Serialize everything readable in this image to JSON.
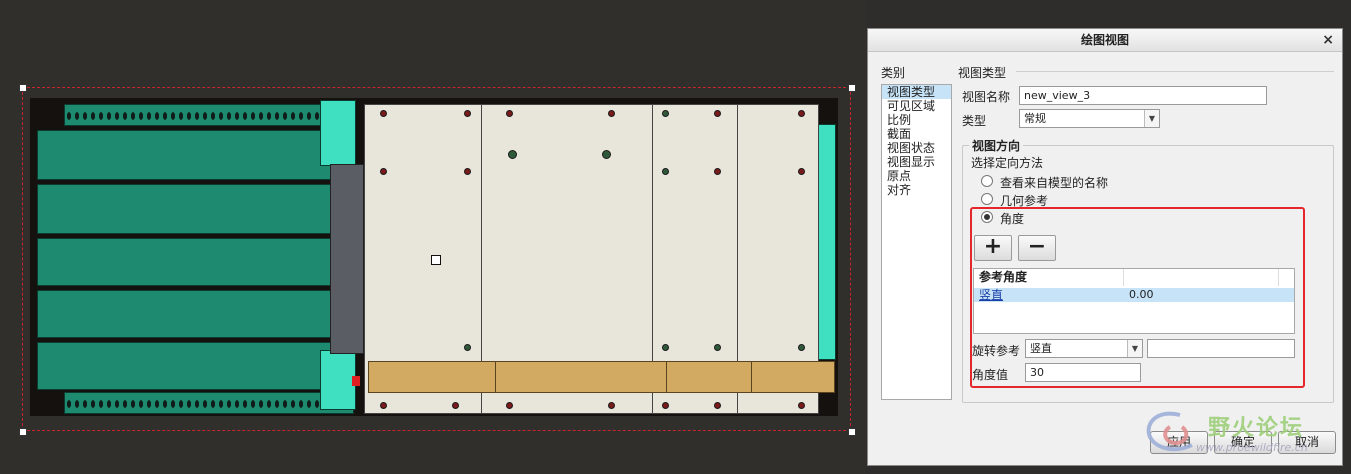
{
  "dialog": {
    "title": "绘图视图",
    "close": "×",
    "category_label": "类别",
    "categories": [
      "视图类型",
      "可见区域",
      "比例",
      "截面",
      "视图状态",
      "视图显示",
      "原点",
      "对齐"
    ],
    "section_title": "视图类型",
    "view_name_label": "视图名称",
    "view_name_value": "new_view_3",
    "type_label": "类型",
    "type_value": "常规",
    "orientation_group": "视图方向",
    "method_label": "选择定向方法",
    "methods": [
      "查看来自模型的名称",
      "几何参考",
      "角度"
    ],
    "selected_method": "角度",
    "add_symbol": "+",
    "remove_symbol": "−",
    "table_header_ref": "参考角度",
    "table_row_ref": "竖直",
    "table_row_value": "0.00",
    "rotate_ref_label": "旋转参考",
    "rotate_ref_value": "竖直",
    "angle_value_label": "角度值",
    "angle_value": "30",
    "apply": "应用",
    "ok": "确定",
    "cancel": "取消"
  },
  "watermark": {
    "text": "野火论坛",
    "url": "www.proewildfire.cn"
  },
  "colors": {
    "highlight_box": "#e3272d",
    "heatsink": "#1e8a6f",
    "mint": "#3fe0c1",
    "plate": "#e8e5da",
    "bar": "#d2aa62"
  }
}
